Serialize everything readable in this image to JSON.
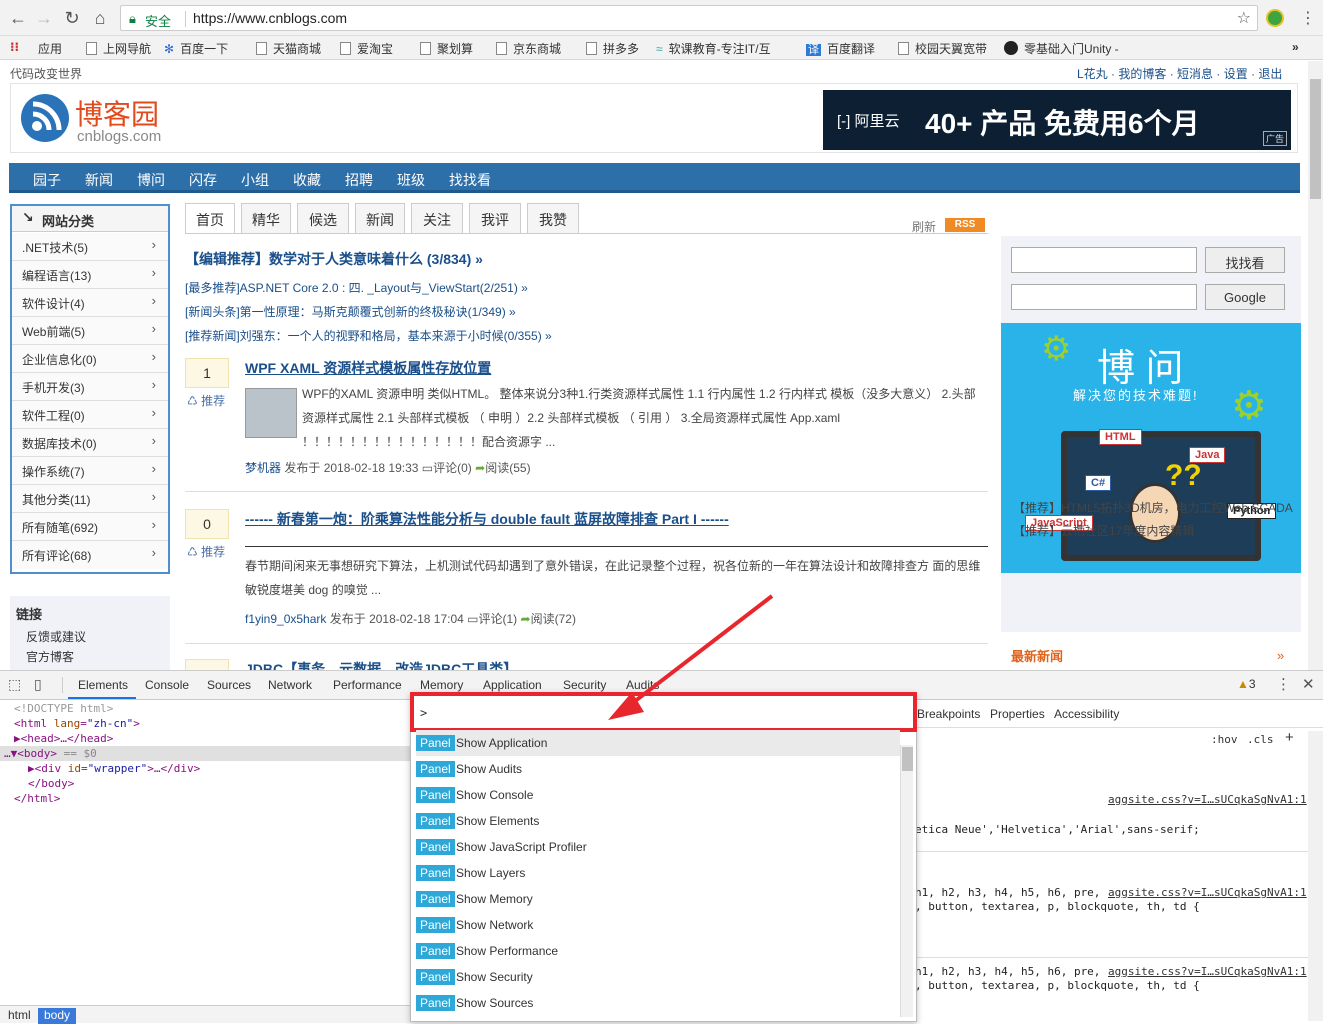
{
  "browser": {
    "secure_label": "安全",
    "url": "https://www.cnblogs.com",
    "bookmarks": [
      "应用",
      "上网导航",
      "百度一下",
      "天猫商城",
      "爱淘宝",
      "聚划算",
      "京东商城",
      "拼多多",
      "软课教育-专注IT/互",
      "百度翻译",
      "校园天翼宽带",
      "零基础入门Unity -"
    ],
    "bookmarks_more": "»"
  },
  "site": {
    "slogan": "代码改变世界",
    "user_links": [
      "L花丸",
      "我的博客",
      "短消息",
      "设置",
      "退出"
    ],
    "logo_title": "博客园",
    "logo_sub": "cnblogs.com",
    "ad": {
      "brand": "阿里云",
      "slogan": "40+ 产品 免费用6个月",
      "tag": "广告"
    },
    "nav": [
      "园子",
      "新闻",
      "博问",
      "闪存",
      "小组",
      "收藏",
      "招聘",
      "班级",
      "找找看"
    ],
    "categories_title": "网站分类",
    "categories": [
      ".NET技术(5)",
      "编程语言(13)",
      "软件设计(4)",
      "Web前端(5)",
      "企业信息化(0)",
      "手机开发(3)",
      "软件工程(0)",
      "数据库技术(0)",
      "操作系统(7)",
      "其他分类(11)",
      "所有随笔(692)",
      "所有评论(68)"
    ],
    "links_title": "链接",
    "links": [
      "反馈或建议",
      "官方博客"
    ],
    "tabs": [
      "首页",
      "精华",
      "候选",
      "新闻",
      "关注",
      "我评",
      "我赞"
    ],
    "refresh": "刷新",
    "rss": "RSS",
    "editor_pick": "【编辑推荐】数学对于人类意味着什么 (3/834) »",
    "headlines": [
      "[最多推荐]ASP.NET Core 2.0 : 四. _Layout与_ViewStart(2/251) »",
      "[新闻头条]第一性原理：马斯克颠覆式创新的终极秘诀(1/349) »",
      "[推荐新闻]刘强东：一个人的视野和格局，基本来源于小时候(0/355) »"
    ],
    "posts": [
      {
        "votes": "1",
        "recommend": "推荐",
        "title": "WPF XAML 资源样式模板属性存放位置",
        "lines": [
          "WPF的XAML 资源申明 类似HTML。 整体来说分3种1.行类资源样式属性 1.1 行内属性 1.2 行内样式 模板（没多大意义） 2.头部",
          "资源样式属性 2.1 头部样式模板 （ 申明 ）2.2 头部样式模板 （ 引用 ） 3.全局资源样式属性 App.xaml",
          "！！！！！！！！！！！！！！！配合资源字 ..."
        ],
        "author": "梦机器",
        "posted": "发布于 2018-02-18 19:33",
        "comments": "评论(0)",
        "reads": "阅读(55)"
      },
      {
        "votes": "0",
        "recommend": "推荐",
        "title": "------ 新春第一炮：阶乘算法性能分析与 double fault 蓝屏故障排查 Part I ------",
        "lines": [
          "春节期间闲来无事想研究下算法，上机测试代码却遇到了意外错误，在此记录整个过程，祝各位新的一年在算法设计和故障排查方 面的思维",
          "敏锐度堪美 dog 的嗅觉 ..."
        ],
        "author": "f1yin9_0x5hark",
        "posted": "发布于 2018-02-18 17:04",
        "comments": "评论(1)",
        "reads": "阅读(72)"
      }
    ],
    "next_post_title": "JDBC【事务、元数据、改造JDBC工具类】",
    "search_btn": "找找看",
    "google_btn": "Google",
    "banner_title": "博 问",
    "banner_sub": "解决您的技术难题!",
    "banner_tags": [
      "HTML",
      "Java",
      "C#",
      "Python",
      "JavaScript"
    ],
    "promos": [
      "【推荐】HTML5拓扑3D机房，电力工控Web SCADA",
      "【推荐】云栖社区17年度内容精辑"
    ],
    "new_news": "最新新闻",
    "new_news_more": "»"
  },
  "devtools": {
    "tabs": [
      "Elements",
      "Console",
      "Sources",
      "Network",
      "Performance",
      "Memory",
      "Application",
      "Security",
      "Audits"
    ],
    "warnings": "3",
    "dom": {
      "doctype": "<!DOCTYPE html>",
      "html_open": "<html",
      "lang_attr": "lang",
      "lang_val": "\"zh-cn\"",
      "head": "<head>…</head>",
      "body": "<body>",
      "body_eq": "== $0",
      "div_open": "<div",
      "id_attr": "id",
      "id_val": "\"wrapper\"",
      "div_close": ">…</div>",
      "body_close": "</body>",
      "html_close": "</html>"
    },
    "crumbs": [
      "html",
      "body"
    ],
    "side_tabs": [
      "Breakpoints",
      "Properties",
      "Accessibility"
    ],
    "hov": ":hov",
    "cls": ".cls",
    "style_links": [
      "aggsite.css?v=I…sUCqkaSgNvA1:1",
      "aggsite.css?v=I…sUCqkaSgNvA1:1",
      "aggsite.css?v=I…sUCqkaSgNvA1:1"
    ],
    "style_rules": [
      "etica Neue','Helvetica','Arial',sans-serif;",
      "h1, h2, h3, h4, h5, h6, pre,",
      ", button, textarea, p, blockquote, th, td {",
      "h1, h2, h3, h4, h5, h6, pre,",
      ", button, textarea, p, blockquote, th, td {"
    ],
    "command_menu": {
      "prompt": ">",
      "badge": "Panel",
      "items": [
        "Show Application",
        "Show Audits",
        "Show Console",
        "Show Elements",
        "Show JavaScript Profiler",
        "Show Layers",
        "Show Memory",
        "Show Network",
        "Show Performance",
        "Show Security",
        "Show Sources"
      ]
    }
  },
  "colors": {
    "accent_red": "#e8262d",
    "panel_badge": "#2ea8d8",
    "nav_blue": "#2d6fa8"
  }
}
